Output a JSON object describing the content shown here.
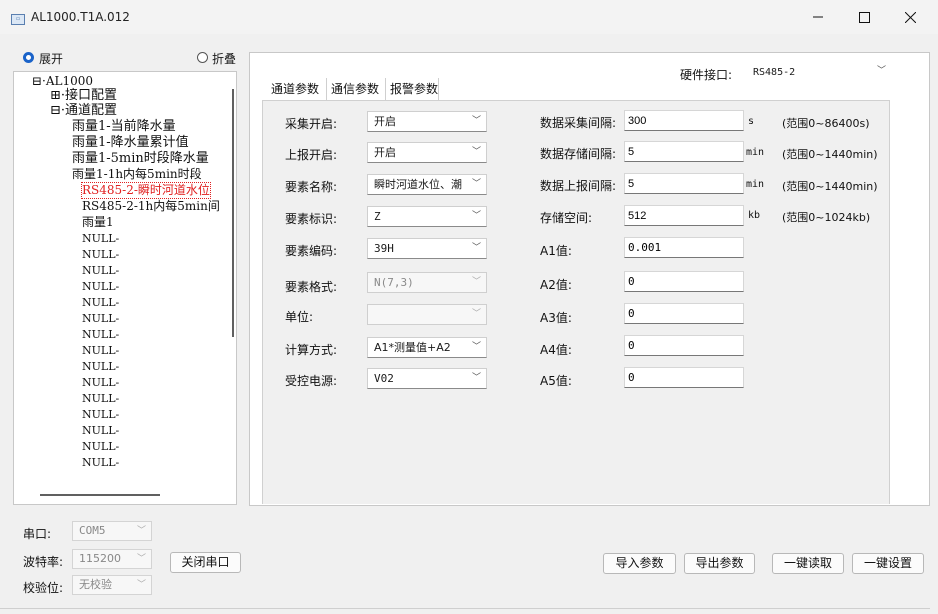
{
  "window": {
    "title": "AL1000.T1A.012"
  },
  "tree_panel": {
    "expand_label": "展开",
    "collapse_label": "折叠",
    "items": [
      "⊟·AL1000",
      "⊞·接口配置",
      "⊟·通道配置",
      "雨量1-当前降水量",
      "雨量1-降水量累计值",
      "雨量1-5min时段降水量",
      "雨量1-1h内每5min时段",
      "RS485-2-瞬时河道水位",
      "RS485-2-1h内每5min间",
      "雨量1",
      "NULL-",
      "NULL-",
      "NULL-",
      "NULL-",
      "NULL-",
      "NULL-",
      "NULL-",
      "NULL-",
      "NULL-",
      "NULL-",
      "NULL-",
      "NULL-",
      "NULL-",
      "NULL-",
      "NULL-"
    ]
  },
  "tabs": [
    "通道参数",
    "通信参数",
    "报警参数"
  ],
  "hardware": {
    "label": "硬件接口:",
    "value": "RS485-2"
  },
  "left_form": {
    "collect_enable": {
      "label": "采集开启:",
      "value": "开启"
    },
    "report_enable": {
      "label": "上报开启:",
      "value": "开启"
    },
    "element_name": {
      "label": "要素名称:",
      "value": "瞬时河道水位、潮"
    },
    "element_id": {
      "label": "要素标识:",
      "value": "Z"
    },
    "element_code": {
      "label": "要素编码:",
      "value": "39H"
    },
    "element_format": {
      "label": "要素格式:",
      "value": "N(7,3)"
    },
    "unit": {
      "label": "单位:",
      "value": ""
    },
    "calc_method": {
      "label": "计算方式:",
      "value": "A1*测量值+A2"
    },
    "power": {
      "label": "受控电源:",
      "value": "V02"
    }
  },
  "right_form": {
    "collect_interval": {
      "label": "数据采集间隔:",
      "value": "300",
      "unit": "s",
      "range": "(范围0~86400s)"
    },
    "store_interval": {
      "label": "数据存储间隔:",
      "value": "5",
      "unit": "min",
      "range": "(范围0~1440min)"
    },
    "report_interval": {
      "label": "数据上报间隔:",
      "value": "5",
      "unit": "min",
      "range": "(范围0~1440min)"
    },
    "storage": {
      "label": "存储空间:",
      "value": "512",
      "unit": "kb",
      "range": "(范围0~1024kb)"
    },
    "a1": {
      "label": "A1值:",
      "value": "0.001"
    },
    "a2": {
      "label": "A2值:",
      "value": "0"
    },
    "a3": {
      "label": "A3值:",
      "value": "0"
    },
    "a4": {
      "label": "A4值:",
      "value": "0"
    },
    "a5": {
      "label": "A5值:",
      "value": "0"
    }
  },
  "serial": {
    "port_label": "串口:",
    "port_value": "COM5",
    "baud_label": "波特率:",
    "baud_value": "115200",
    "parity_label": "校验位:",
    "parity_value": "无校验",
    "close_button": "关闭串口"
  },
  "actions": {
    "import": "导入参数",
    "export": "导出参数",
    "read_all": "一键读取",
    "set_all": "一键设置"
  },
  "colors": {
    "selected_tree_item": "#e02020",
    "radio_active": "#1a63c9"
  }
}
